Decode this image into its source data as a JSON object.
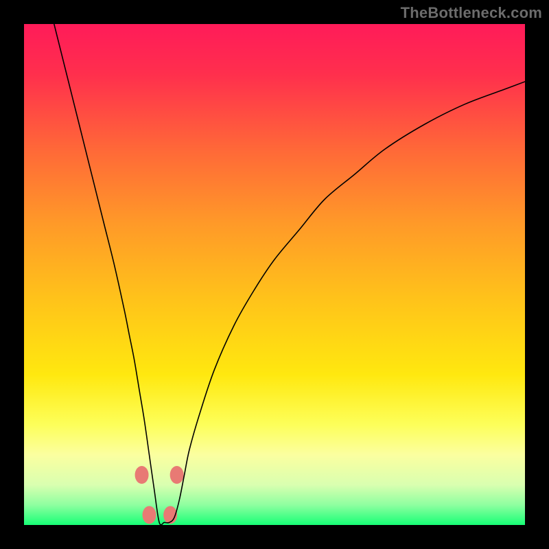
{
  "watermark": "TheBottleneck.com",
  "chart_data": {
    "type": "line",
    "title": "",
    "xlabel": "",
    "ylabel": "",
    "xlim": [
      0,
      100
    ],
    "ylim": [
      0,
      100
    ],
    "background_gradient": {
      "stops": [
        {
          "pos": 0.0,
          "color": "#ff1b59"
        },
        {
          "pos": 0.1,
          "color": "#ff2f4d"
        },
        {
          "pos": 0.25,
          "color": "#ff6838"
        },
        {
          "pos": 0.4,
          "color": "#ff9a28"
        },
        {
          "pos": 0.55,
          "color": "#ffc31a"
        },
        {
          "pos": 0.7,
          "color": "#ffe80f"
        },
        {
          "pos": 0.8,
          "color": "#fdff5a"
        },
        {
          "pos": 0.86,
          "color": "#fbffa0"
        },
        {
          "pos": 0.92,
          "color": "#d9ffb0"
        },
        {
          "pos": 0.96,
          "color": "#8effa0"
        },
        {
          "pos": 1.0,
          "color": "#17ff76"
        }
      ]
    },
    "curve_min_x": 27,
    "series": [
      {
        "name": "bottleneck-curve",
        "x": [
          6,
          8,
          10,
          12,
          14,
          16,
          18,
          20,
          21,
          22,
          23,
          24,
          25,
          26,
          27,
          28,
          29,
          30,
          31,
          32,
          33,
          35,
          38,
          42,
          46,
          50,
          55,
          60,
          66,
          72,
          80,
          88,
          96,
          100
        ],
        "values": [
          100,
          92,
          84,
          76,
          68,
          60,
          52,
          43,
          38,
          33,
          27,
          21,
          14,
          7,
          0.5,
          0.5,
          0.5,
          1.5,
          5,
          10,
          15,
          22,
          31,
          40,
          47,
          53,
          59,
          65,
          70,
          75,
          80,
          84,
          87,
          88.5
        ]
      }
    ],
    "highlight_dots": {
      "color": "#e87a74",
      "points": [
        {
          "x": 23.5,
          "y": 10
        },
        {
          "x": 30.5,
          "y": 10
        },
        {
          "x": 25.0,
          "y": 2
        },
        {
          "x": 29.2,
          "y": 2
        }
      ]
    }
  }
}
